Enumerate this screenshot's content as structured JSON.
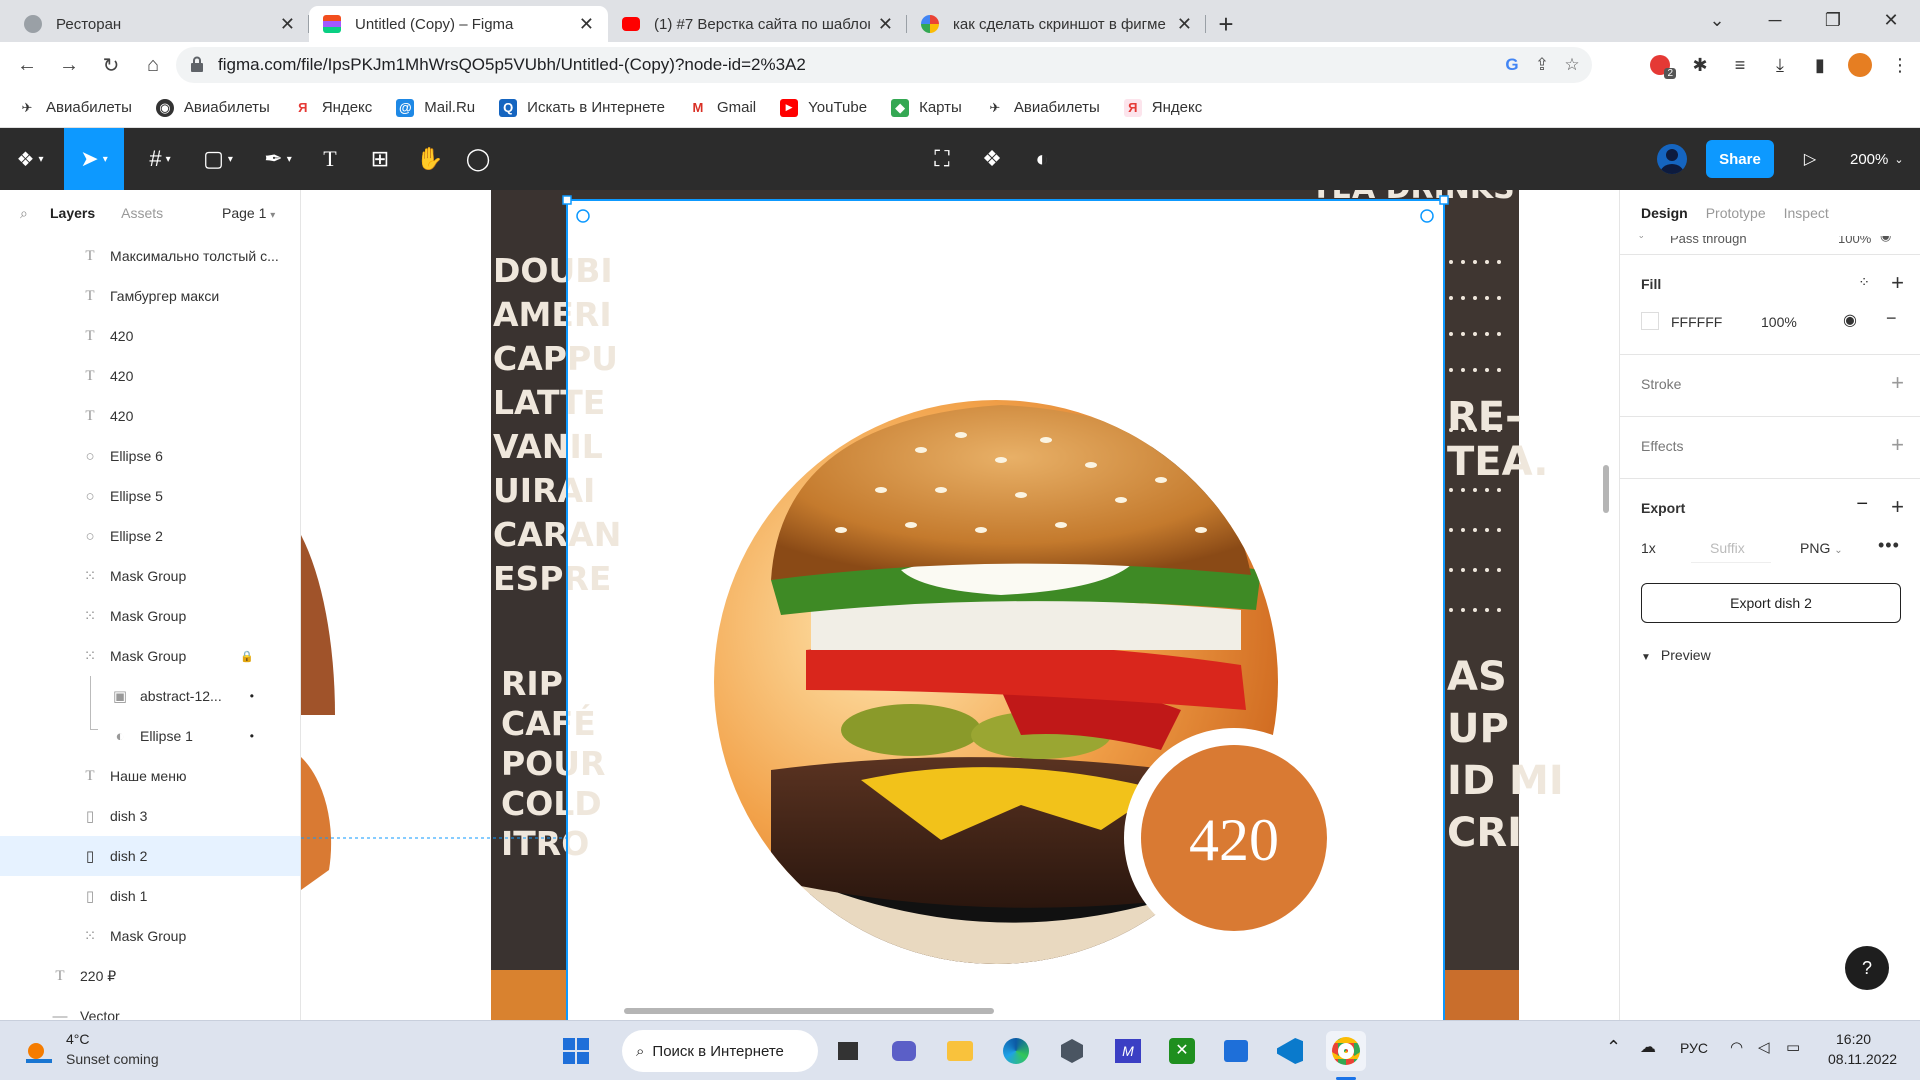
{
  "browser": {
    "tabs": [
      {
        "title": "Ресторан",
        "active": false
      },
      {
        "title": "Untitled (Copy) – Figma",
        "active": true
      },
      {
        "title": "(1) #7 Верстка сайта по шаблон",
        "active": false
      },
      {
        "title": "как сделать скриншот в фигме",
        "active": false
      }
    ],
    "url": "figma.com/file/IpsPKJm1MhWrsQO5p5VUbh/Untitled-(Copy)?node-id=2%3A2",
    "ext_badge": "2",
    "bookmarks": [
      "Авиабилеты",
      "Авиабилеты",
      "Яндекс",
      "Mail.Ru",
      "Искать в Интернете",
      "Gmail",
      "YouTube",
      "Карты",
      "Авиабилеты",
      "Яндекс"
    ]
  },
  "figma": {
    "share_label": "Share",
    "zoom": "200%",
    "left_tabs": {
      "layers": "Layers",
      "assets": "Assets",
      "page": "Page 1"
    },
    "layers": [
      {
        "name": "Максимально толстый с...",
        "icon": "text"
      },
      {
        "name": "Гамбургер макси",
        "icon": "text"
      },
      {
        "name": "420",
        "icon": "text"
      },
      {
        "name": "420",
        "icon": "text"
      },
      {
        "name": "420",
        "icon": "text"
      },
      {
        "name": "Ellipse 6",
        "icon": "ellipse"
      },
      {
        "name": "Ellipse 5",
        "icon": "ellipse"
      },
      {
        "name": "Ellipse 2",
        "icon": "ellipse"
      },
      {
        "name": "Mask Group",
        "icon": "group"
      },
      {
        "name": "Mask Group",
        "icon": "group"
      },
      {
        "name": "Mask Group",
        "icon": "group",
        "locked": true
      },
      {
        "name": "abstract-12...",
        "icon": "image",
        "dot": true
      },
      {
        "name": "Ellipse 1",
        "icon": "mask",
        "dot": true
      },
      {
        "name": "Наше меню",
        "icon": "text"
      },
      {
        "name": "dish 3",
        "icon": "frame"
      },
      {
        "name": "dish 2",
        "icon": "frame",
        "selected": true
      },
      {
        "name": "dish 1",
        "icon": "frame"
      },
      {
        "name": "Mask Group",
        "icon": "group"
      },
      {
        "name": "220 ₽",
        "icon": "text"
      },
      {
        "name": "Vector",
        "icon": "line"
      }
    ],
    "right": {
      "tabs": [
        "Design",
        "Prototype",
        "Inspect"
      ],
      "layer_blend": "Pass through",
      "layer_opacity": "100%",
      "fill_label": "Fill",
      "fill_hex": "FFFFFF",
      "fill_opacity": "100%",
      "stroke_label": "Stroke",
      "effects_label": "Effects",
      "export_label": "Export",
      "export_scale": "1x",
      "export_suffix_placeholder": "Suffix",
      "export_format": "PNG",
      "export_button": "Export dish 2",
      "preview_label": "Preview"
    },
    "canvas": {
      "price": "420",
      "bg_words": [
        "DOUBI",
        "AMERI",
        "CAPPU",
        "LATTE",
        "VANIL",
        "UIRAI",
        "CARAN",
        "ESPRE",
        "RIP",
        "CAFÉ",
        "POUR",
        "COLD",
        "ITRO"
      ],
      "right_words": [
        "RE-",
        "TEA.",
        "AS",
        "UP",
        "ID MI",
        "CRI"
      ],
      "top_words": [
        "TEA DRINKS"
      ]
    }
  },
  "taskbar": {
    "weather_temp": "4°C",
    "weather_text": "Sunset coming",
    "search": "Поиск в Интернете",
    "lang": "РУС",
    "time": "16:20",
    "date": "08.11.2022"
  },
  "colors": {
    "figma_blue": "#0d99ff",
    "price_orange": "#d97a33",
    "toolbar_dark": "#2c2c2c"
  }
}
